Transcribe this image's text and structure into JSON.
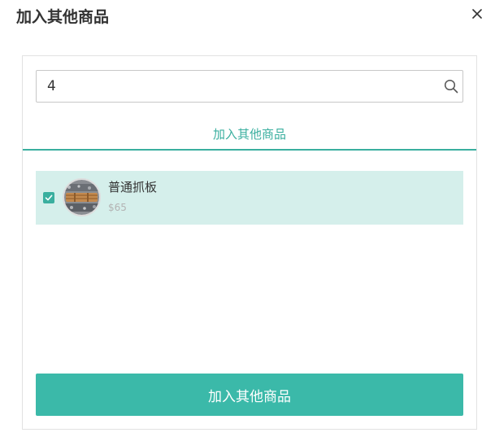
{
  "dialog": {
    "title": "加入其他商品",
    "close_icon": "close-icon"
  },
  "search": {
    "value": "4",
    "icon": "search-icon"
  },
  "tabs": [
    {
      "label": "加入其他商品",
      "active": true
    }
  ],
  "products": [
    {
      "name": "普通抓板",
      "price": "$65",
      "checked": true
    }
  ],
  "actions": {
    "submit_label": "加入其他商品"
  },
  "colors": {
    "accent": "#3aaf9f",
    "selected_row": "#d5efeb",
    "button": "#3bb9a9"
  }
}
